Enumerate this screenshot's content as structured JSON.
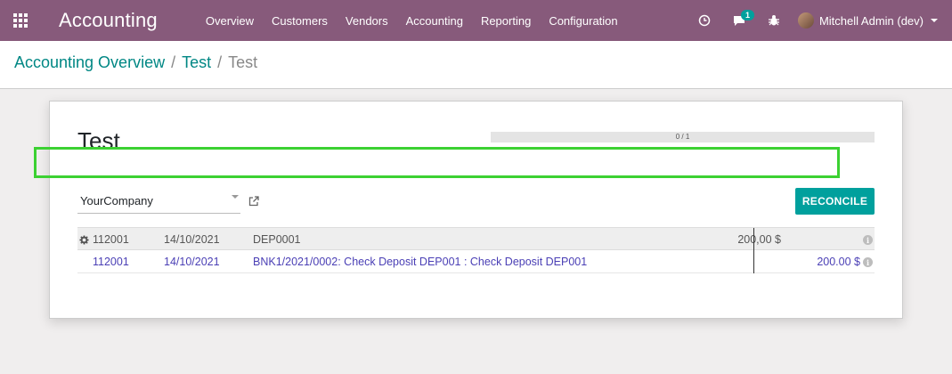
{
  "navbar": {
    "app_name": "Accounting",
    "menu": [
      "Overview",
      "Customers",
      "Vendors",
      "Accounting",
      "Reporting",
      "Configuration"
    ],
    "messages_badge": "1",
    "user_name": "Mitchell Admin (dev)"
  },
  "breadcrumb": {
    "items": [
      "Accounting Overview",
      "Test"
    ],
    "current": "Test",
    "separator": "/"
  },
  "form": {
    "title": "Test",
    "progress_text": "0 / 1",
    "progress_fraction": 0,
    "company": "YourCompany",
    "reconcile_label": "RECONCILE"
  },
  "statement_line": {
    "account": "112001",
    "date": "14/10/2021",
    "label": "DEP0001",
    "amount": "200,00 $"
  },
  "matched_line": {
    "account": "112001",
    "date": "14/10/2021",
    "label": "BNK1/2021/0002: Check Deposit DEP001 : Check Deposit DEP001",
    "amount": "200.00 $"
  },
  "colors": {
    "navbar": "#875a7b",
    "accent": "#00a09d",
    "highlight": "#3cd132"
  }
}
